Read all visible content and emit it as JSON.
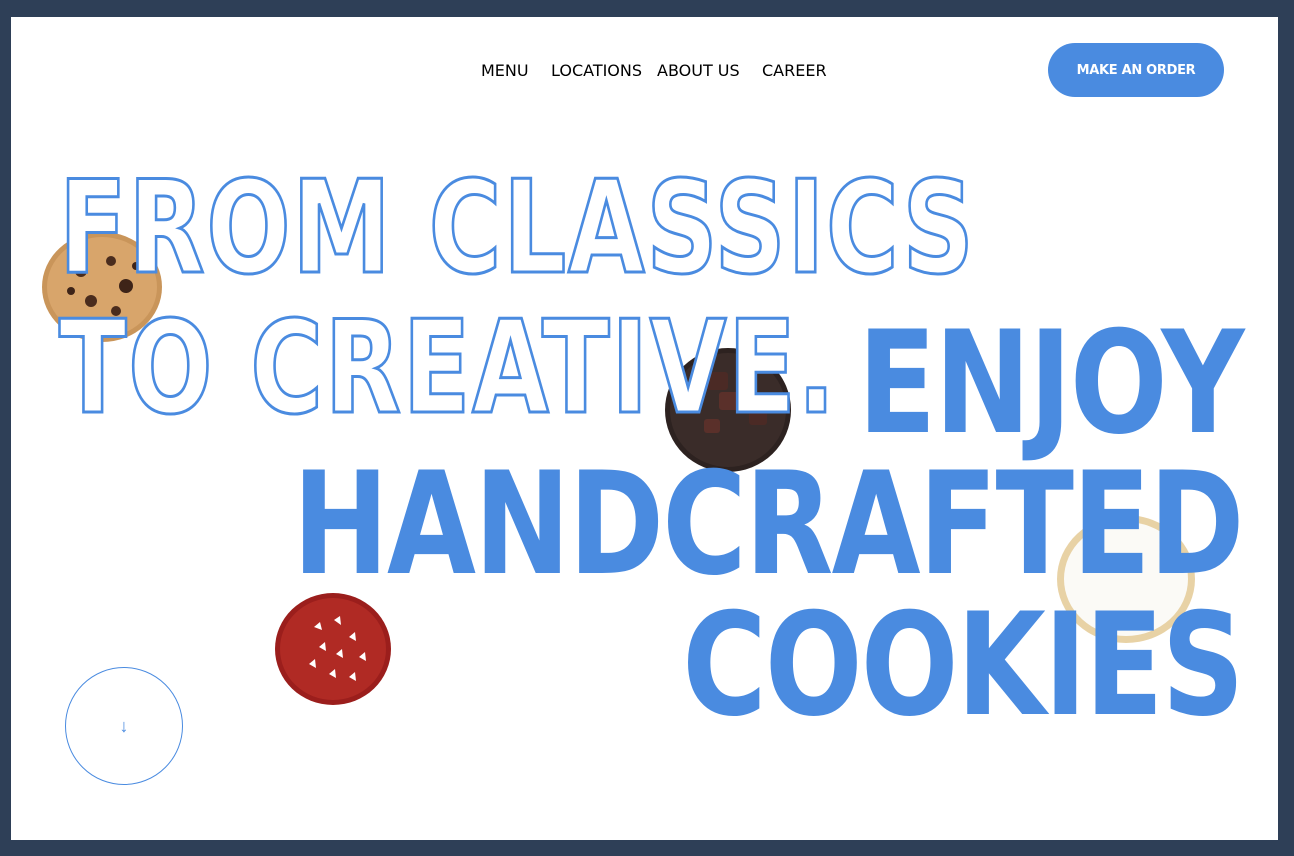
{
  "nav": {
    "items": [
      "MENU",
      "LOCATIONS",
      "ABOUT US",
      "CAREER"
    ]
  },
  "cta": {
    "label": "MAKE AN ORDER"
  },
  "hero": {
    "outline_line1": "FROM CLASSICS",
    "outline_line2": "TO CREATIVE.",
    "solid_line1": "ENJOY",
    "solid_line2": "HANDCRAFTED",
    "solid_line3": "COOKIES"
  },
  "scroll_button": {
    "icon": "arrow-down-icon",
    "glyph": "↓"
  },
  "colors": {
    "accent": "#4a8be0",
    "frame": "#2e3f57",
    "background": "#ffffff"
  }
}
